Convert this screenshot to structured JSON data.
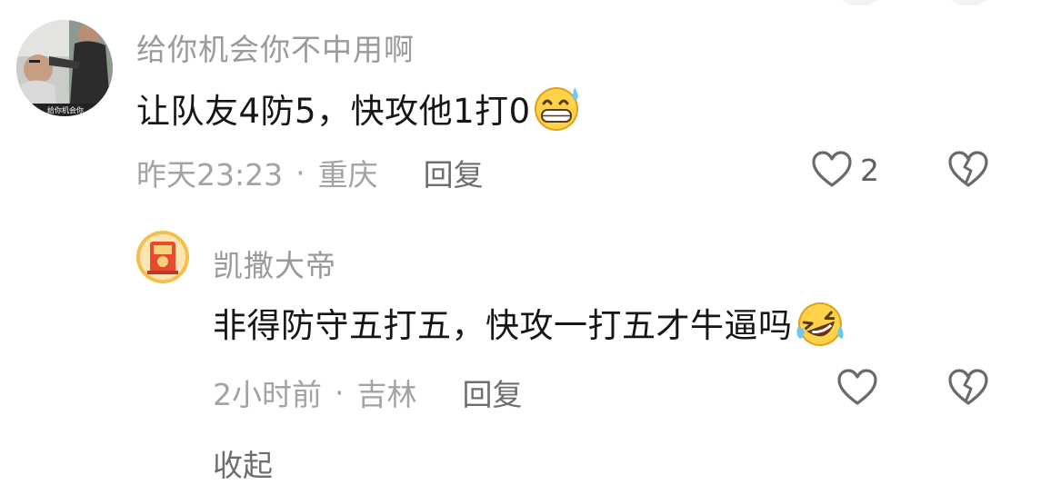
{
  "comments": [
    {
      "username": "给你机会你不中用啊",
      "avatar_caption": "给你机会你",
      "content": "让队友4防5，快攻他1打0",
      "emoji": "grinning-sweat-emoji",
      "time": "昨天23:23",
      "separator": "·",
      "location": "重庆",
      "reply_label": "回复",
      "like_count": "2"
    },
    {
      "username": "凯撒大帝",
      "content": "非得防守五打五，快攻一打五才牛逼吗",
      "emoji": "rolling-laughing-emoji",
      "time": "2小时前",
      "separator": "·",
      "location": "吉林",
      "reply_label": "回复",
      "like_count": ""
    }
  ],
  "collapse_label": "收起",
  "colors": {
    "username": "#9a9a9a",
    "content": "#161616",
    "meta": "#a3a3a3",
    "reply": "#6d6d6d",
    "icon_stroke": "#6a6a6a"
  }
}
